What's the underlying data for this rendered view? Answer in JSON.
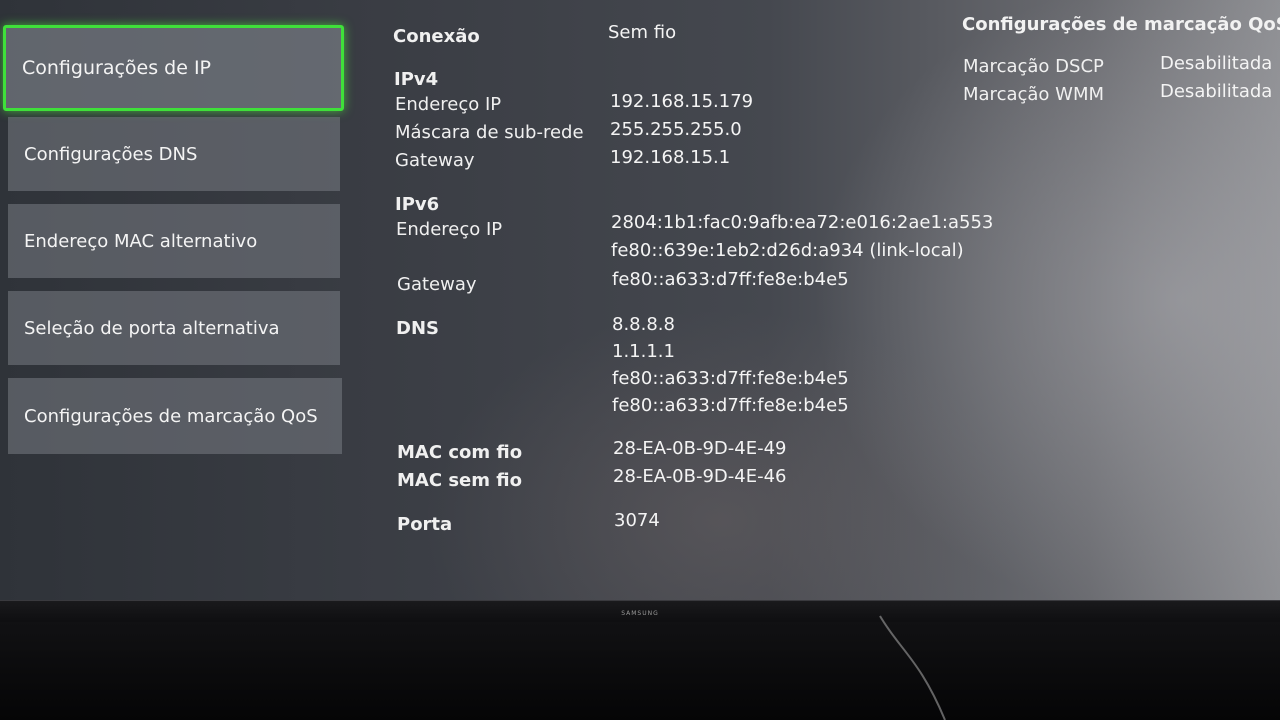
{
  "menu": {
    "items": [
      {
        "label": "Configurações de IP"
      },
      {
        "label": "Configurações DNS"
      },
      {
        "label": "Endereço MAC alternativo"
      },
      {
        "label": "Seleção de porta alternativa"
      },
      {
        "label": "Configurações de marcação QoS"
      }
    ]
  },
  "details": {
    "connection_label": "Conexão",
    "connection_value": "Sem fio",
    "ipv4": {
      "heading": "IPv4",
      "ip_label": "Endereço IP",
      "ip_value": "192.168.15.179",
      "mask_label": "Máscara de sub-rede",
      "mask_value": "255.255.255.0",
      "gateway_label": "Gateway",
      "gateway_value": "192.168.15.1"
    },
    "ipv6": {
      "heading": "IPv6",
      "ip_label": "Endereço IP",
      "ip_values": [
        "2804:1b1:fac0:9afb:ea72:e016:2ae1:a553",
        "fe80::639e:1eb2:d26d:a934 (link-local)"
      ],
      "gateway_label": "Gateway",
      "gateway_value": "fe80::a633:d7ff:fe8e:b4e5"
    },
    "dns": {
      "label": "DNS",
      "values": [
        "8.8.8.8",
        "1.1.1.1",
        "fe80::a633:d7ff:fe8e:b4e5",
        "fe80::a633:d7ff:fe8e:b4e5"
      ]
    },
    "mac_wired_label": "MAC com fio",
    "mac_wired_value": "28-EA-0B-9D-4E-49",
    "mac_wireless_label": "MAC sem fio",
    "mac_wireless_value": "28-EA-0B-9D-4E-46",
    "port_label": "Porta",
    "port_value": "3074"
  },
  "qos": {
    "title": "Configurações de marcação QoS",
    "dscp_label": "Marcação DSCP",
    "dscp_value": "Desabilitada",
    "wmm_label": "Marcação WMM",
    "wmm_value": "Desabilitada"
  },
  "tv": {
    "brand": "SAMSUNG"
  },
  "colors": {
    "focus": "#3fe03a"
  }
}
